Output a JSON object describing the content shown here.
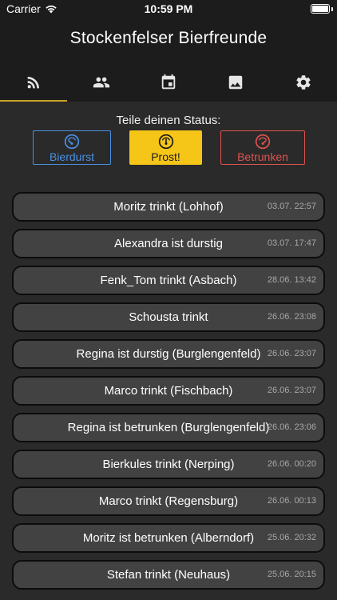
{
  "status_bar": {
    "carrier": "Carrier",
    "time": "10:59 PM"
  },
  "app": {
    "title": "Stockenfelser Bierfreunde",
    "accent_color": "#c9a227"
  },
  "tabs": [
    {
      "icon": "rss-feed-icon",
      "active": true
    },
    {
      "icon": "people-icon",
      "active": false
    },
    {
      "icon": "calendar-icon",
      "active": false
    },
    {
      "icon": "image-icon",
      "active": false
    },
    {
      "icon": "gear-icon",
      "active": false
    }
  ],
  "status_share": {
    "label": "Teile deinen Status:",
    "buttons": [
      {
        "label": "Bierdurst",
        "color": "#4a90e2",
        "icon": "gauge-low-icon"
      },
      {
        "label": "Prost!",
        "color": "#f5c518",
        "icon": "gauge-mid-icon"
      },
      {
        "label": "Betrunken",
        "color": "#e0524f",
        "icon": "gauge-high-icon"
      }
    ]
  },
  "feed": [
    {
      "text": "Moritz trinkt (Lohhof)",
      "time": "03.07. 22:57"
    },
    {
      "text": "Alexandra ist durstig",
      "time": "03.07. 17:47"
    },
    {
      "text": "Fenk_Tom trinkt (Asbach)",
      "time": "28.06. 13:42"
    },
    {
      "text": "Schousta trinkt",
      "time": "26.06. 23:08"
    },
    {
      "text": "Regina ist durstig (Burglengenfeld)",
      "time": "26.06. 23:07"
    },
    {
      "text": "Marco trinkt (Fischbach)",
      "time": "26.06. 23:07"
    },
    {
      "text": "Regina ist betrunken (Burglengenfeld)",
      "time": "26.06. 23:06"
    },
    {
      "text": "Bierkules trinkt (Nerping)",
      "time": "26.06. 00:20"
    },
    {
      "text": "Marco trinkt (Regensburg)",
      "time": "26.06. 00:13"
    },
    {
      "text": "Moritz ist betrunken (Alberndorf)",
      "time": "25.06. 20:32"
    },
    {
      "text": "Stefan trinkt (Neuhaus)",
      "time": "25.06. 20:15"
    }
  ]
}
